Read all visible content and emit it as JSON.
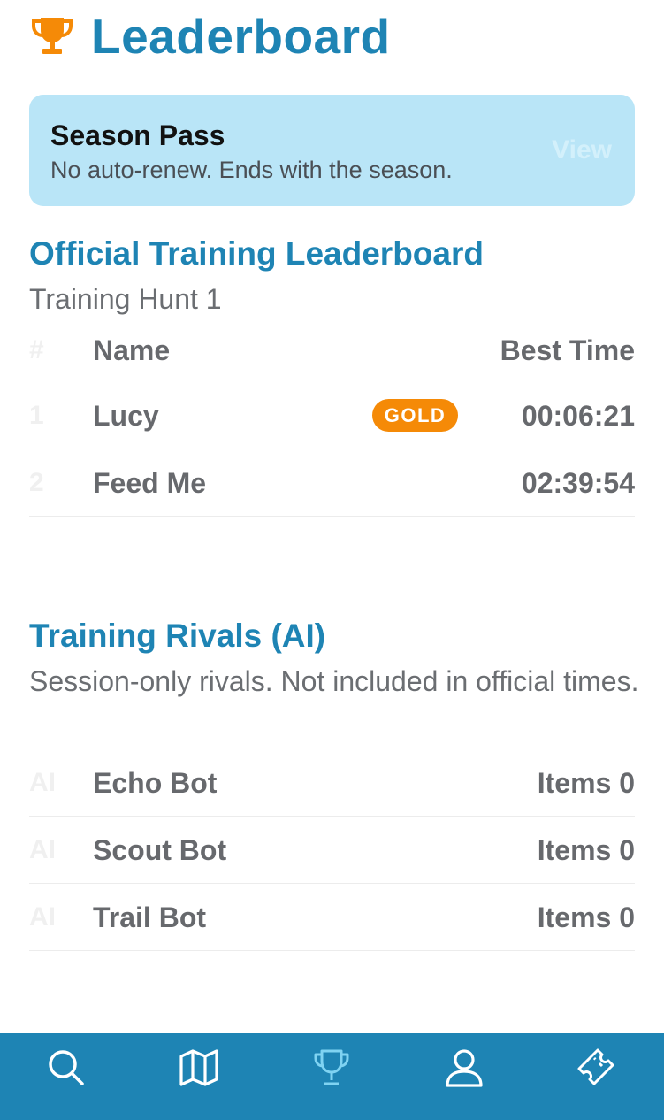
{
  "header": {
    "icon": "trophy-icon",
    "title": "Leaderboard",
    "accent_color": "#1E84B4",
    "icon_color": "#F58A07"
  },
  "season_pass": {
    "title": "Season Pass",
    "subtitle": "No auto-renew. Ends with the season.",
    "action_label": "View"
  },
  "official": {
    "title": "Official Training Leaderboard",
    "subtitle": "Training Hunt 1",
    "columns": {
      "rank": "#",
      "name": "Name",
      "value": "Best Time"
    },
    "rows": [
      {
        "rank": "1",
        "name": "Lucy",
        "badge": "GOLD",
        "value": "00:06:21"
      },
      {
        "rank": "2",
        "name": "Feed Me",
        "badge": "",
        "value": "02:39:54"
      }
    ]
  },
  "rivals": {
    "title": "Training Rivals (AI)",
    "subtitle": "Session-only rivals. Not included in official times.",
    "rows": [
      {
        "rank": "AI",
        "name": "Echo Bot",
        "value": "Items 0"
      },
      {
        "rank": "AI",
        "name": "Scout Bot",
        "value": "Items 0"
      },
      {
        "rank": "AI",
        "name": "Trail Bot",
        "value": "Items 0"
      }
    ]
  },
  "tabbar": {
    "background": "#1E84B4",
    "tabs": [
      {
        "icon": "search-icon"
      },
      {
        "icon": "map-icon"
      },
      {
        "icon": "trophy-icon",
        "active": true
      },
      {
        "icon": "profile-icon"
      },
      {
        "icon": "ticket-icon"
      }
    ]
  }
}
